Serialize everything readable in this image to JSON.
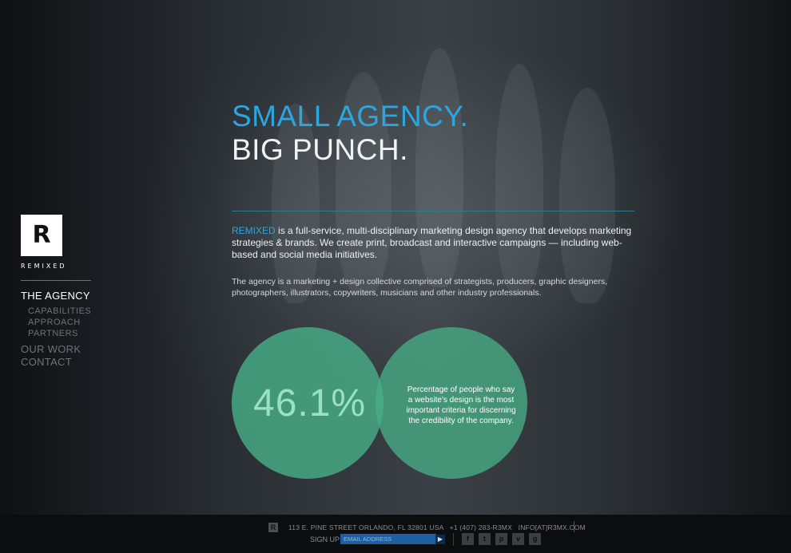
{
  "headline": {
    "line1": "SMALL AGENCY.",
    "line2": "BIG PUNCH."
  },
  "logo": {
    "letter": "R",
    "wordmark": "REMIXED"
  },
  "nav": {
    "main": [
      {
        "label": "THE AGENCY",
        "active": true
      },
      {
        "label": "OUR WORK",
        "active": false
      },
      {
        "label": "CONTACT",
        "active": false
      }
    ],
    "sub": [
      "CAPABILITIES",
      "APPROACH",
      "PARTNERS"
    ]
  },
  "intro": {
    "brand": "REMIXED",
    "text": " is a full-service, multi-disciplinary marketing design agency that develops marketing strategies & brands. We create print, broadcast and interactive campaigns — including web-based and social media initiatives."
  },
  "about": "The agency is a marketing + design collective comprised of strategists, producers, graphic designers, photographers, illustrators, copywriters, musicians and other industry professionals.",
  "stat": {
    "value": "46.1%",
    "caption": "Percentage of people who say a website's design is the most important criteria for discerning the credibility of the company."
  },
  "footer": {
    "icon_letter": "R",
    "address": "113 E. PINE STREET ORLANDO, FL 32801 USA   +1 (407) 283-R3MX   INFO[AT]R3MX.COM",
    "signup_label": "SIGN UP",
    "email_placeholder": "EMAIL ADDRESS",
    "go_glyph": "▶",
    "social": [
      "f",
      "t",
      "p",
      "v",
      "g"
    ]
  },
  "colors": {
    "accent_blue": "#2ba6e0",
    "circle_green": "#48ad87"
  },
  "icons": {
    "footer_logo": "remixed-r-icon",
    "submit": "play-arrow-icon",
    "social": [
      "facebook-icon",
      "twitter-icon",
      "pinterest-icon",
      "vimeo-icon",
      "google-plus-icon"
    ]
  }
}
